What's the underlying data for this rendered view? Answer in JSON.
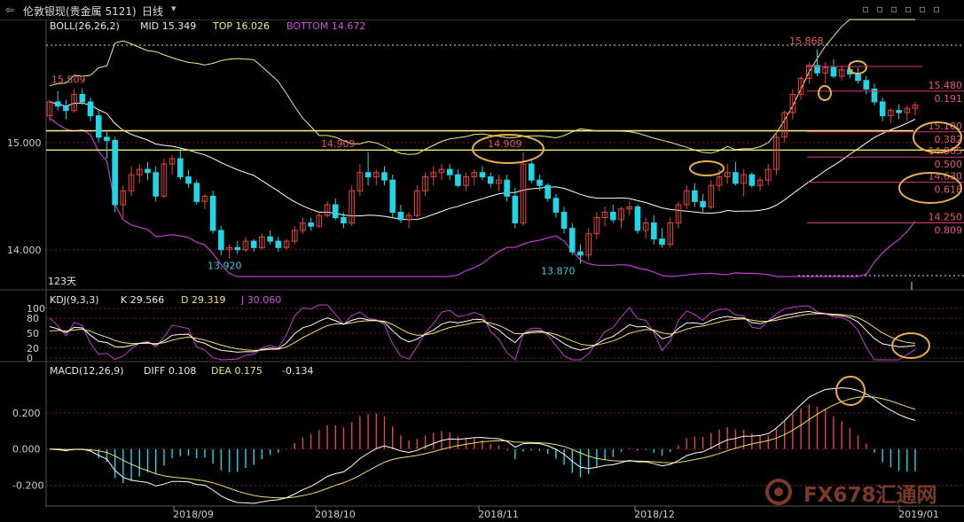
{
  "window": {
    "title": "伦敦银现(贵金属 5121)",
    "period": "日线",
    "toolbar_icons": [
      "back-icon",
      "next-icon",
      "zoom-in-icon",
      "zoom-out-icon",
      "grid-icon",
      "fullscreen-icon",
      "settings-icon",
      "close-icon"
    ]
  },
  "colors": {
    "up": "#e8453c",
    "down": "#1fd6e6",
    "mid": "#ffffff",
    "top": "#f0ef7a",
    "bottom": "#c03dd0",
    "hline": "#f5e878",
    "fib": "#d23b78",
    "annot": "#e8b04a",
    "k": "#ffffff",
    "d": "#f0e06a",
    "j": "#c03dd0",
    "grid": "#7a1a1a"
  },
  "boll": {
    "name": "BOLL(26,26,2)",
    "mid_label": "MID 15.349",
    "top_label": "TOP 16.026",
    "bottom_label": "BOTTOM 14.672"
  },
  "kdj": {
    "name": "KDJ(9,3,3)",
    "k_label": "K 29.566",
    "d_label": "D 29.319",
    "j_label": "J 30.060",
    "ticks": [
      "100",
      "80",
      "50",
      "20",
      "0"
    ]
  },
  "macd": {
    "name": "MACD(12,26,9)",
    "diff_label": "DIFF 0.108",
    "dea_label": "DEA 0.175",
    "val_label": "-0.134",
    "ticks": [
      "0.200",
      "0.000",
      "-0.200"
    ]
  },
  "price_axis": [
    "15.000",
    "14.000"
  ],
  "days_label": "123天",
  "x_axis": [
    "2018/09",
    "2018/10",
    "2018/11",
    "2018/12",
    "2019/01"
  ],
  "price_labels": {
    "high_start": "15.509",
    "low_sep": "13.920",
    "peak_oct": "14.909",
    "peak_nov": "14.909",
    "low_nov": "13.870",
    "peak_dec": "15.868"
  },
  "fib_levels": [
    {
      "price": "15.480",
      "ratio": "0.191"
    },
    {
      "price": "15.100",
      "ratio": "0.382"
    },
    {
      "price": "14.865",
      "ratio": "0.500"
    },
    {
      "price": "14.630",
      "ratio": "0.618"
    },
    {
      "price": "14.250",
      "ratio": "0.809"
    }
  ],
  "watermark": "FX678汇通网",
  "chart_data": {
    "type": "candlestick",
    "title": "伦敦银现(贵金属 5121) 日线",
    "x_ticks": [
      "2018/09",
      "2018/10",
      "2018/11",
      "2018/12",
      "2019/01"
    ],
    "y_ticks": [
      15.0,
      14.0
    ],
    "ylim": [
      13.75,
      16.0
    ],
    "ohlc": [
      [
        15.25,
        15.4,
        15.2,
        15.38
      ],
      [
        15.38,
        15.48,
        15.3,
        15.34
      ],
      [
        15.34,
        15.4,
        15.22,
        15.3
      ],
      [
        15.3,
        15.5,
        15.28,
        15.45
      ],
      [
        15.45,
        15.509,
        15.35,
        15.38
      ],
      [
        15.38,
        15.42,
        15.2,
        15.25
      ],
      [
        15.25,
        15.3,
        15.0,
        15.05
      ],
      [
        15.05,
        15.1,
        14.85,
        15.02
      ],
      [
        15.02,
        15.05,
        14.35,
        14.42
      ],
      [
        14.42,
        14.6,
        14.3,
        14.55
      ],
      [
        14.55,
        14.78,
        14.5,
        14.7
      ],
      [
        14.7,
        14.8,
        14.62,
        14.75
      ],
      [
        14.75,
        14.82,
        14.65,
        14.72
      ],
      [
        14.72,
        14.78,
        14.45,
        14.5
      ],
      [
        14.5,
        14.85,
        14.48,
        14.8
      ],
      [
        14.8,
        14.88,
        14.7,
        14.85
      ],
      [
        14.85,
        14.95,
        14.65,
        14.68
      ],
      [
        14.68,
        14.75,
        14.58,
        14.62
      ],
      [
        14.62,
        14.65,
        14.42,
        14.45
      ],
      [
        14.45,
        14.52,
        14.38,
        14.5
      ],
      [
        14.5,
        14.55,
        14.15,
        14.18
      ],
      [
        14.18,
        14.22,
        13.95,
        14.0
      ],
      [
        14.0,
        14.05,
        13.92,
        14.02
      ],
      [
        14.02,
        14.08,
        13.96,
        14.0
      ],
      [
        14.0,
        14.12,
        13.98,
        14.08
      ],
      [
        14.08,
        14.1,
        13.98,
        14.02
      ],
      [
        14.02,
        14.15,
        14.0,
        14.12
      ],
      [
        14.12,
        14.18,
        14.05,
        14.08
      ],
      [
        14.08,
        14.12,
        13.98,
        14.02
      ],
      [
        14.02,
        14.1,
        14.0,
        14.08
      ],
      [
        14.08,
        14.22,
        14.05,
        14.18
      ],
      [
        14.18,
        14.3,
        14.15,
        14.25
      ],
      [
        14.25,
        14.3,
        14.18,
        14.22
      ],
      [
        14.22,
        14.35,
        14.2,
        14.32
      ],
      [
        14.32,
        14.45,
        14.3,
        14.42
      ],
      [
        14.42,
        14.48,
        14.28,
        14.3
      ],
      [
        14.3,
        14.35,
        14.2,
        14.25
      ],
      [
        14.25,
        14.6,
        14.22,
        14.55
      ],
      [
        14.55,
        14.8,
        14.5,
        14.72
      ],
      [
        14.72,
        14.909,
        14.6,
        14.68
      ],
      [
        14.68,
        14.75,
        14.6,
        14.72
      ],
      [
        14.72,
        14.78,
        14.6,
        14.65
      ],
      [
        14.65,
        14.7,
        14.3,
        14.35
      ],
      [
        14.35,
        14.42,
        14.25,
        14.28
      ],
      [
        14.28,
        14.35,
        14.2,
        14.32
      ],
      [
        14.32,
        14.6,
        14.3,
        14.55
      ],
      [
        14.55,
        14.72,
        14.5,
        14.68
      ],
      [
        14.68,
        14.78,
        14.6,
        14.72
      ],
      [
        14.72,
        14.8,
        14.65,
        14.75
      ],
      [
        14.75,
        14.8,
        14.65,
        14.7
      ],
      [
        14.7,
        14.75,
        14.58,
        14.6
      ],
      [
        14.6,
        14.72,
        14.55,
        14.68
      ],
      [
        14.68,
        14.75,
        14.6,
        14.72
      ],
      [
        14.72,
        14.78,
        14.65,
        14.68
      ],
      [
        14.68,
        14.72,
        14.58,
        14.62
      ],
      [
        14.62,
        14.7,
        14.55,
        14.65
      ],
      [
        14.65,
        14.7,
        14.45,
        14.5
      ],
      [
        14.5,
        14.58,
        14.2,
        14.25
      ],
      [
        14.25,
        14.909,
        14.22,
        14.8
      ],
      [
        14.8,
        14.85,
        14.62,
        14.65
      ],
      [
        14.65,
        14.7,
        14.55,
        14.6
      ],
      [
        14.6,
        14.62,
        14.45,
        14.48
      ],
      [
        14.48,
        14.52,
        14.3,
        14.35
      ],
      [
        14.35,
        14.4,
        14.15,
        14.2
      ],
      [
        14.2,
        14.25,
        13.95,
        13.98
      ],
      [
        13.98,
        14.05,
        13.87,
        13.95
      ],
      [
        13.95,
        14.2,
        13.9,
        14.15
      ],
      [
        14.15,
        14.35,
        14.1,
        14.3
      ],
      [
        14.3,
        14.4,
        14.22,
        14.35
      ],
      [
        14.35,
        14.42,
        14.25,
        14.28
      ],
      [
        14.28,
        14.4,
        14.2,
        14.38
      ],
      [
        14.38,
        14.45,
        14.32,
        14.4
      ],
      [
        14.4,
        14.42,
        14.15,
        14.18
      ],
      [
        14.18,
        14.3,
        14.1,
        14.25
      ],
      [
        14.25,
        14.32,
        14.05,
        14.1
      ],
      [
        14.1,
        14.2,
        14.02,
        14.05
      ],
      [
        14.05,
        14.3,
        14.02,
        14.25
      ],
      [
        14.25,
        14.45,
        14.2,
        14.42
      ],
      [
        14.42,
        14.6,
        14.38,
        14.55
      ],
      [
        14.55,
        14.62,
        14.4,
        14.45
      ],
      [
        14.45,
        14.52,
        14.35,
        14.4
      ],
      [
        14.4,
        14.65,
        14.38,
        14.6
      ],
      [
        14.6,
        14.75,
        14.55,
        14.68
      ],
      [
        14.68,
        14.8,
        14.62,
        14.72
      ],
      [
        14.72,
        14.82,
        14.6,
        14.62
      ],
      [
        14.62,
        14.75,
        14.5,
        14.7
      ],
      [
        14.7,
        14.72,
        14.58,
        14.6
      ],
      [
        14.6,
        14.68,
        14.55,
        14.65
      ],
      [
        14.65,
        14.8,
        14.6,
        14.75
      ],
      [
        14.75,
        15.1,
        14.7,
        15.05
      ],
      [
        15.05,
        15.3,
        15.0,
        15.28
      ],
      [
        15.28,
        15.5,
        15.22,
        15.45
      ],
      [
        15.45,
        15.62,
        15.4,
        15.6
      ],
      [
        15.6,
        15.75,
        15.55,
        15.72
      ],
      [
        15.72,
        15.868,
        15.62,
        15.65
      ],
      [
        15.65,
        15.75,
        15.55,
        15.7
      ],
      [
        15.7,
        15.78,
        15.6,
        15.62
      ],
      [
        15.62,
        15.72,
        15.58,
        15.68
      ],
      [
        15.68,
        15.75,
        15.6,
        15.64
      ],
      [
        15.64,
        15.7,
        15.55,
        15.58
      ],
      [
        15.58,
        15.62,
        15.45,
        15.5
      ],
      [
        15.5,
        15.55,
        15.35,
        15.38
      ],
      [
        15.38,
        15.42,
        15.2,
        15.25
      ],
      [
        15.25,
        15.32,
        15.18,
        15.3
      ],
      [
        15.3,
        15.36,
        15.22,
        15.28
      ],
      [
        15.28,
        15.35,
        15.2,
        15.32
      ],
      [
        15.32,
        15.38,
        15.25,
        15.35
      ]
    ],
    "fib_levels": [
      15.48,
      15.1,
      14.865,
      14.63,
      14.25
    ],
    "boll_labels": {
      "mid": 15.349,
      "top": 16.026,
      "bottom": 14.672
    },
    "kdj": {
      "k": 29.566,
      "d": 29.319,
      "j": 30.06,
      "ylim": [
        0,
        100
      ]
    },
    "macd": {
      "diff": 0.108,
      "dea": 0.175,
      "macd": -0.134,
      "ylim": [
        -0.3,
        0.4
      ]
    }
  }
}
